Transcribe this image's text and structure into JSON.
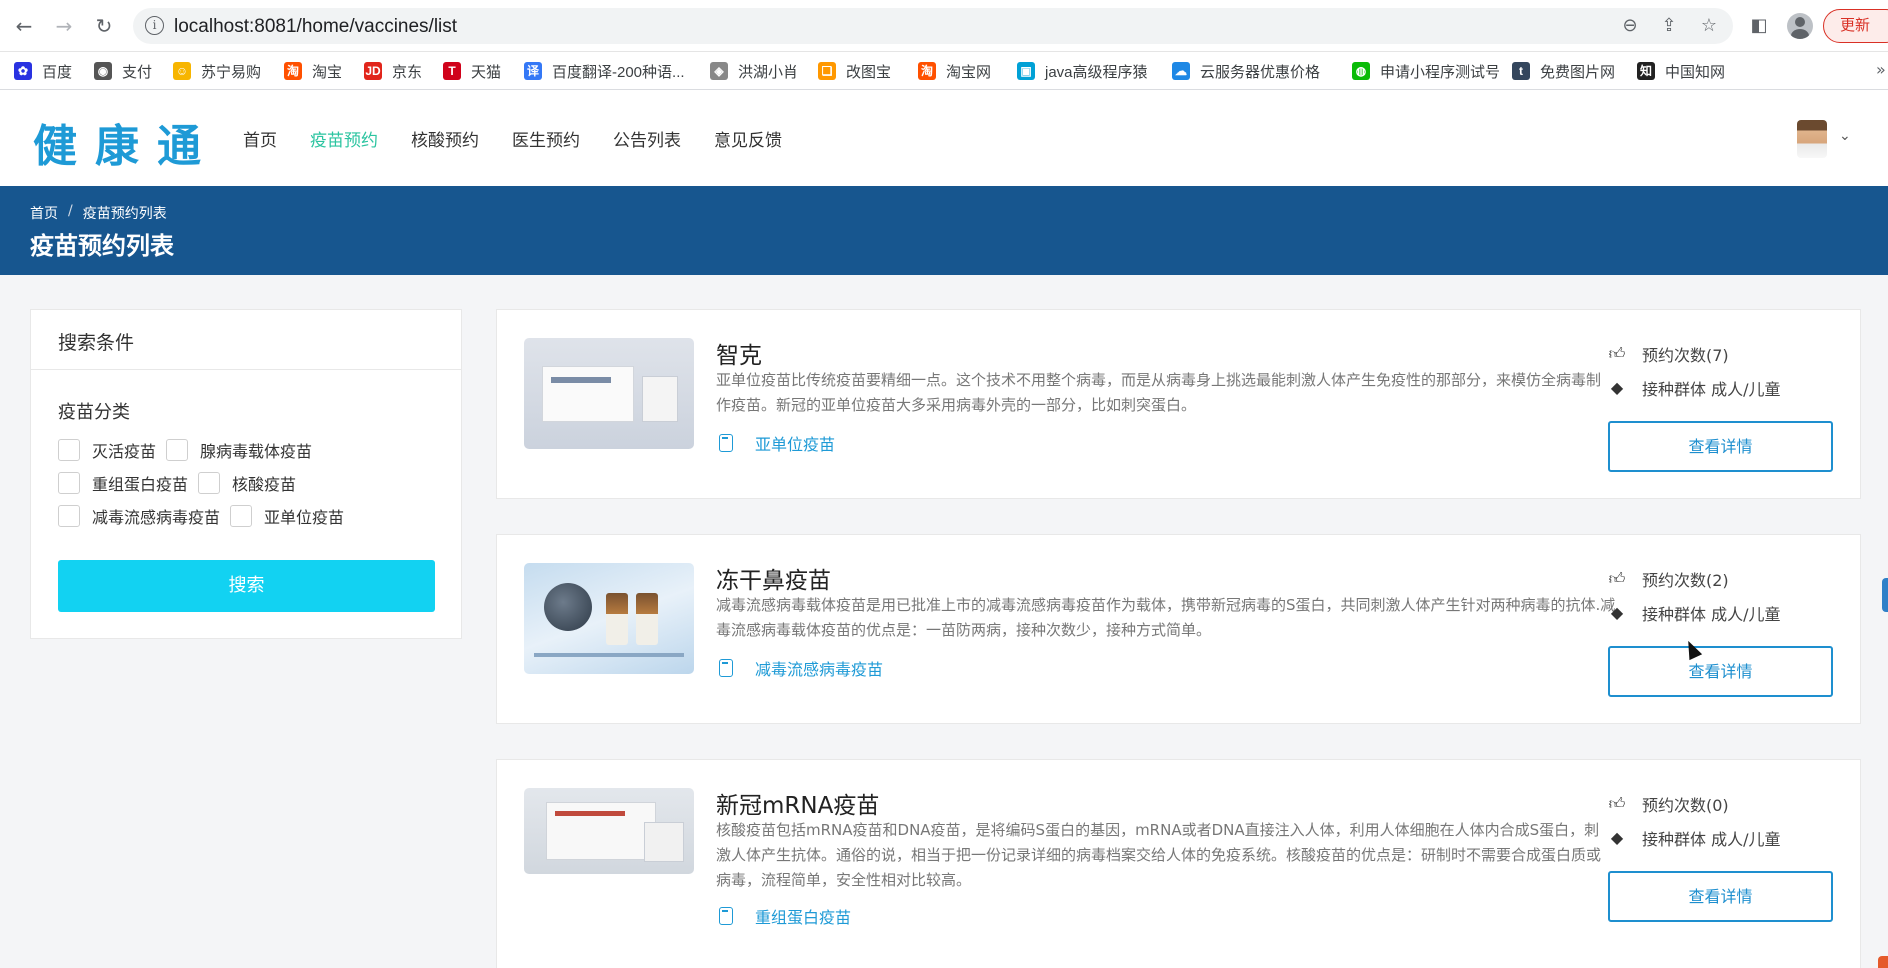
{
  "browser": {
    "url": "localhost:8081/home/vaccines/list",
    "update_label": "更新",
    "bookmarks": [
      {
        "label": "百度",
        "icon": "baidu-icon",
        "color": "#2932e1",
        "glyph": "✿"
      },
      {
        "label": "支付",
        "icon": "pay-icon",
        "color": "#555555",
        "glyph": "◉"
      },
      {
        "label": "苏宁易购",
        "icon": "suning-icon",
        "color": "#f7b500",
        "glyph": "☺"
      },
      {
        "label": "淘宝",
        "icon": "taobao-icon",
        "color": "#ff5000",
        "glyph": "淘"
      },
      {
        "label": "京东",
        "icon": "jd-icon",
        "color": "#e1251b",
        "glyph": "JD"
      },
      {
        "label": "天猫",
        "icon": "tmall-icon",
        "color": "#d0021b",
        "glyph": "T"
      },
      {
        "label": "百度翻译-200种语...",
        "icon": "translate-icon",
        "color": "#3478f6",
        "glyph": "译"
      },
      {
        "label": "洪湖小肖",
        "icon": "shield-icon",
        "color": "#888888",
        "glyph": "◈"
      },
      {
        "label": "改图宝",
        "icon": "gaitu-icon",
        "color": "#ff9800",
        "glyph": "❏"
      },
      {
        "label": "淘宝网",
        "icon": "taobao-net-icon",
        "color": "#ff5000",
        "glyph": "淘"
      },
      {
        "label": "java高级程序猿",
        "icon": "bilibili-icon",
        "color": "#00a1d6",
        "glyph": "▣"
      },
      {
        "label": "云服务器优惠价格",
        "icon": "cloud-icon",
        "color": "#1e88e5",
        "glyph": "☁"
      },
      {
        "label": "申请小程序测试号",
        "icon": "wechat-icon",
        "color": "#09bb07",
        "glyph": "◍"
      },
      {
        "label": "免费图片网",
        "icon": "tumblr-icon",
        "color": "#34465d",
        "glyph": "t"
      },
      {
        "label": "中国知网",
        "icon": "cnki-icon",
        "color": "#222222",
        "glyph": "知"
      }
    ]
  },
  "site": {
    "logo": "健康通",
    "nav": [
      {
        "label": "首页",
        "active": false
      },
      {
        "label": "疫苗预约",
        "active": true
      },
      {
        "label": "核酸预约",
        "active": false
      },
      {
        "label": "医生预约",
        "active": false
      },
      {
        "label": "公告列表",
        "active": false
      },
      {
        "label": "意见反馈",
        "active": false
      }
    ]
  },
  "banner": {
    "breadcrumb_home": "首页",
    "breadcrumb_sep": "/",
    "breadcrumb_current": "疫苗预约列表",
    "title": "疫苗预约列表"
  },
  "search": {
    "header": "搜索条件",
    "category_title": "疫苗分类",
    "rows": [
      [
        "灭活疫苗",
        "腺病毒载体疫苗"
      ],
      [
        "重组蛋白疫苗",
        "核酸疫苗"
      ],
      [
        "减毒流感病毒疫苗",
        "亚单位疫苗"
      ]
    ],
    "button": "搜索"
  },
  "vaccines": [
    {
      "name": "智克",
      "desc": "亚单位疫苗比传统疫苗要精细一点。这个技术不用整个病毒，而是从病毒身上挑选最能刺激人体产生免疫性的那部分，来模仿全病毒制作疫苗。新冠的亚单位疫苗大多采用病毒外壳的一部分，比如刺突蛋白。",
      "category": "亚单位疫苗",
      "count_label": "预约次数(7)",
      "group_label": "接种群体 成人/儿童",
      "detail_label": "查看详情"
    },
    {
      "name": "冻干鼻疫苗",
      "desc": "减毒流感病毒载体疫苗是用已批准上市的减毒流感病毒疫苗作为载体，携带新冠病毒的S蛋白，共同刺激人体产生针对两种病毒的抗体.减毒流感病毒载体疫苗的优点是：一苗防两病，接种次数少，接种方式简单。",
      "category": "减毒流感病毒疫苗",
      "count_label": "预约次数(2)",
      "group_label": "接种群体 成人/儿童",
      "detail_label": "查看详情"
    },
    {
      "name": "新冠mRNA疫苗",
      "desc": "核酸疫苗包括mRNA疫苗和DNA疫苗，是将编码S蛋白的基因，mRNA或者DNA直接注入人体，利用人体细胞在人体内合成S蛋白，刺激人体产生抗体。通俗的说，相当于把一份记录详细的病毒档案交给人体的免疫系统。核酸疫苗的优点是：研制时不需要合成蛋白质或病毒，流程简单，安全性相对比较高。",
      "category": "重组蛋白疫苗",
      "count_label": "预约次数(0)",
      "group_label": "接种群体 成人/儿童",
      "detail_label": "查看详情"
    }
  ],
  "colors": {
    "brand": "#1e9ad6",
    "nav_active": "#2bc4a0",
    "banner": "#17568f",
    "search_button": "#12d2f2"
  }
}
